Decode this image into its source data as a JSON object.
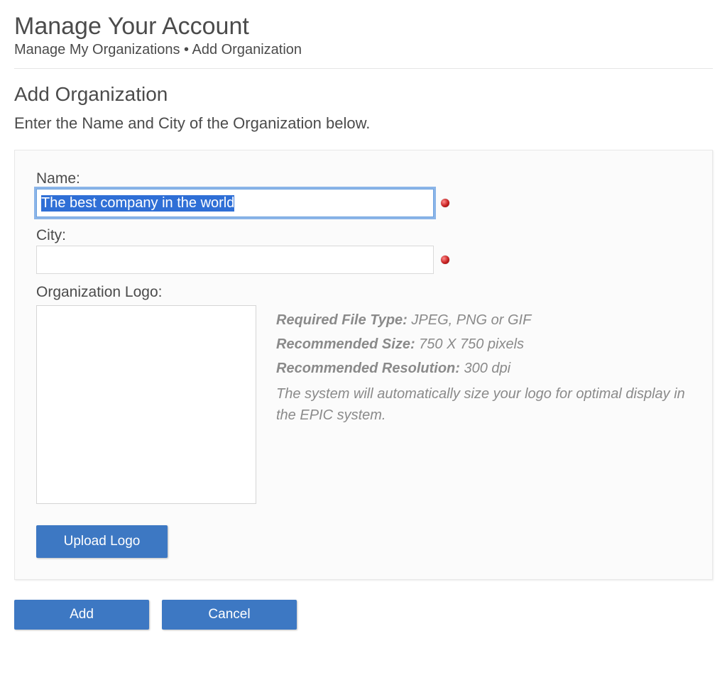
{
  "header": {
    "title": "Manage Your Account",
    "breadcrumb_1": "Manage My Organizations",
    "breadcrumb_sep": "•",
    "breadcrumb_2": "Add Organization"
  },
  "section": {
    "subtitle": "Add Organization",
    "instruction": "Enter the Name and City of the Organization below."
  },
  "form": {
    "name_label": "Name:",
    "name_value": "The best company in the world",
    "city_label": "City:",
    "city_value": "",
    "logo_label": "Organization Logo:"
  },
  "logo_info": {
    "req_type_k": "Required File Type:",
    "req_type_v": "JPEG, PNG or GIF",
    "rec_size_k": "Recommended Size:",
    "rec_size_v": "750 X 750 pixels",
    "rec_res_k": "Recommended Resolution:",
    "rec_res_v": "300 dpi",
    "note": "The system will automatically size your logo for optimal display in the EPIC system."
  },
  "buttons": {
    "upload": "Upload Logo",
    "add": "Add",
    "cancel": "Cancel"
  }
}
